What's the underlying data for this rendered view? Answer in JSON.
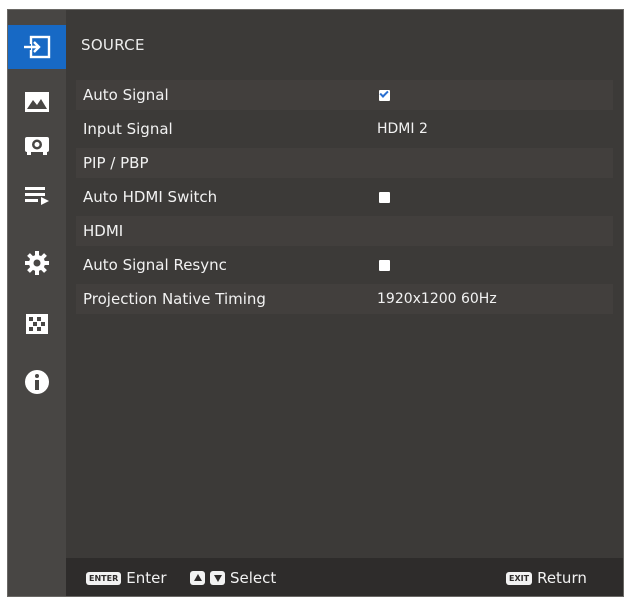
{
  "sidebar": {
    "items": [
      {
        "icon": "source-input-icon",
        "active": true
      },
      {
        "icon": "picture-icon",
        "active": false
      },
      {
        "icon": "projector-icon",
        "active": false
      },
      {
        "icon": "playlist-icon",
        "active": false
      },
      {
        "icon": "gear-icon",
        "active": false
      },
      {
        "icon": "test-pattern-icon",
        "active": false
      },
      {
        "icon": "info-icon",
        "active": false
      }
    ]
  },
  "main": {
    "title": "SOURCE",
    "rows": [
      {
        "label": "Auto Signal",
        "type": "checkbox",
        "checked": true
      },
      {
        "label": "Input Signal",
        "type": "value",
        "value": "HDMI 2"
      },
      {
        "label": "PIP / PBP",
        "type": "submenu"
      },
      {
        "label": "Auto HDMI Switch",
        "type": "checkbox",
        "checked": false
      },
      {
        "label": "HDMI",
        "type": "submenu"
      },
      {
        "label": "Auto Signal Resync",
        "type": "checkbox",
        "checked": false
      },
      {
        "label": "Projection Native Timing",
        "type": "value",
        "value": "1920x1200 60Hz"
      }
    ]
  },
  "footer": {
    "enter_key": "ENTER",
    "enter_label": "Enter",
    "select_label": "Select",
    "exit_key": "EXIT",
    "return_label": "Return"
  },
  "colors": {
    "accent": "#1769c5",
    "panel_bg": "#3c3a38",
    "sidebar_bg": "#484644",
    "footer_bg": "#2e2c2b"
  }
}
